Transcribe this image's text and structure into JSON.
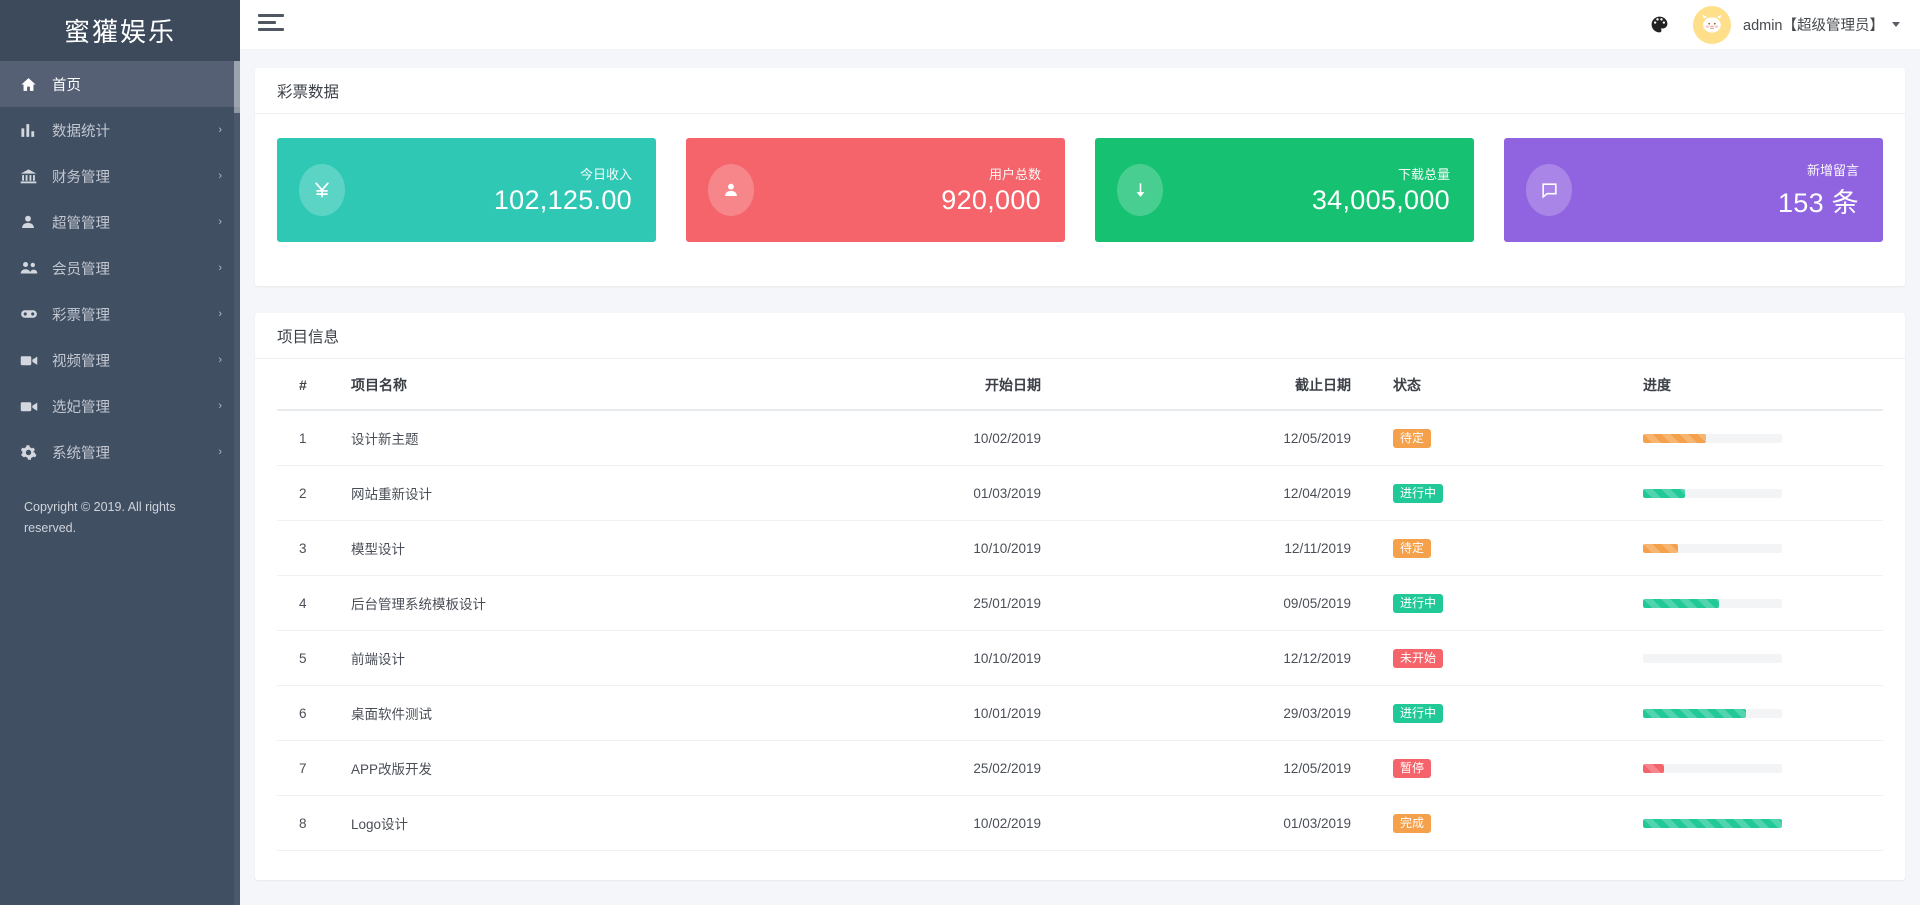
{
  "brand": {
    "title": "蜜獾娱乐"
  },
  "sidebar": {
    "items": [
      {
        "label": "首页",
        "icon": "home-icon",
        "arrow": "",
        "active": true
      },
      {
        "label": "数据统计",
        "icon": "chart-bar-icon",
        "arrow": "›",
        "active": false
      },
      {
        "label": "财务管理",
        "icon": "bank-icon",
        "arrow": "›",
        "active": false
      },
      {
        "label": "超管管理",
        "icon": "person-icon",
        "arrow": "›",
        "active": false
      },
      {
        "label": "会员管理",
        "icon": "people-icon",
        "arrow": "›",
        "active": false
      },
      {
        "label": "彩票管理",
        "icon": "gamepad-icon",
        "arrow": "›",
        "active": false
      },
      {
        "label": "视频管理",
        "icon": "video-icon",
        "arrow": "›",
        "active": false
      },
      {
        "label": "选妃管理",
        "icon": "video-icon",
        "arrow": "›",
        "active": false
      },
      {
        "label": "系统管理",
        "icon": "gear-icon",
        "arrow": "›",
        "active": false
      }
    ],
    "copyright": "Copyright © 2019. All rights reserved."
  },
  "header": {
    "menu_toggle": "hamburger-icon",
    "palette": "palette-icon",
    "avatar": "cat-avatar-icon",
    "user": "admin【超级管理员】",
    "caret": "chevron-down-icon"
  },
  "cards_panel": {
    "title": "彩票数据",
    "cards": [
      {
        "label": "今日收入",
        "value": "102,125.00",
        "color": "#2fc8b5",
        "icon": "yen-icon"
      },
      {
        "label": "用户总数",
        "value": "920,000",
        "color": "#f4646a",
        "icon": "person-icon"
      },
      {
        "label": "下载总量",
        "value": "34,005,000",
        "color": "#16c172",
        "icon": "download-arrow-icon"
      },
      {
        "label": "新增留言",
        "value": "153 条",
        "color": "#9063e0",
        "icon": "comment-icon"
      }
    ]
  },
  "table_panel": {
    "title": "项目信息",
    "columns": [
      "#",
      "项目名称",
      "开始日期",
      "截止日期",
      "状态",
      "进度"
    ],
    "rows": [
      {
        "idx": "1",
        "name": "设计新主题",
        "start": "10/02/2019",
        "end": "12/05/2019",
        "status": "待定",
        "status_color": "#f5a04a",
        "progress": 45,
        "bar_color": "#f5a04a"
      },
      {
        "idx": "2",
        "name": "网站重新设计",
        "start": "01/03/2019",
        "end": "12/04/2019",
        "status": "进行中",
        "status_color": "#20c997",
        "progress": 30,
        "bar_color": "#20c997"
      },
      {
        "idx": "3",
        "name": "模型设计",
        "start": "10/10/2019",
        "end": "12/11/2019",
        "status": "待定",
        "status_color": "#f5a04a",
        "progress": 25,
        "bar_color": "#f5a04a"
      },
      {
        "idx": "4",
        "name": "后台管理系统模板设计",
        "start": "25/01/2019",
        "end": "09/05/2019",
        "status": "进行中",
        "status_color": "#20c997",
        "progress": 55,
        "bar_color": "#20c997"
      },
      {
        "idx": "5",
        "name": "前端设计",
        "start": "10/10/2019",
        "end": "12/12/2019",
        "status": "未开始",
        "status_color": "#f4646a",
        "progress": 0,
        "bar_color": "#f4646a"
      },
      {
        "idx": "6",
        "name": "桌面软件测试",
        "start": "10/01/2019",
        "end": "29/03/2019",
        "status": "进行中",
        "status_color": "#20c997",
        "progress": 74,
        "bar_color": "#20c997"
      },
      {
        "idx": "7",
        "name": "APP改版开发",
        "start": "25/02/2019",
        "end": "12/05/2019",
        "status": "暂停",
        "status_color": "#f4646a",
        "progress": 15,
        "bar_color": "#f4646a"
      },
      {
        "idx": "8",
        "name": "Logo设计",
        "start": "10/02/2019",
        "end": "01/03/2019",
        "status": "完成",
        "status_color": "#f5a04a",
        "progress": 100,
        "bar_color": "#20c997"
      }
    ]
  }
}
